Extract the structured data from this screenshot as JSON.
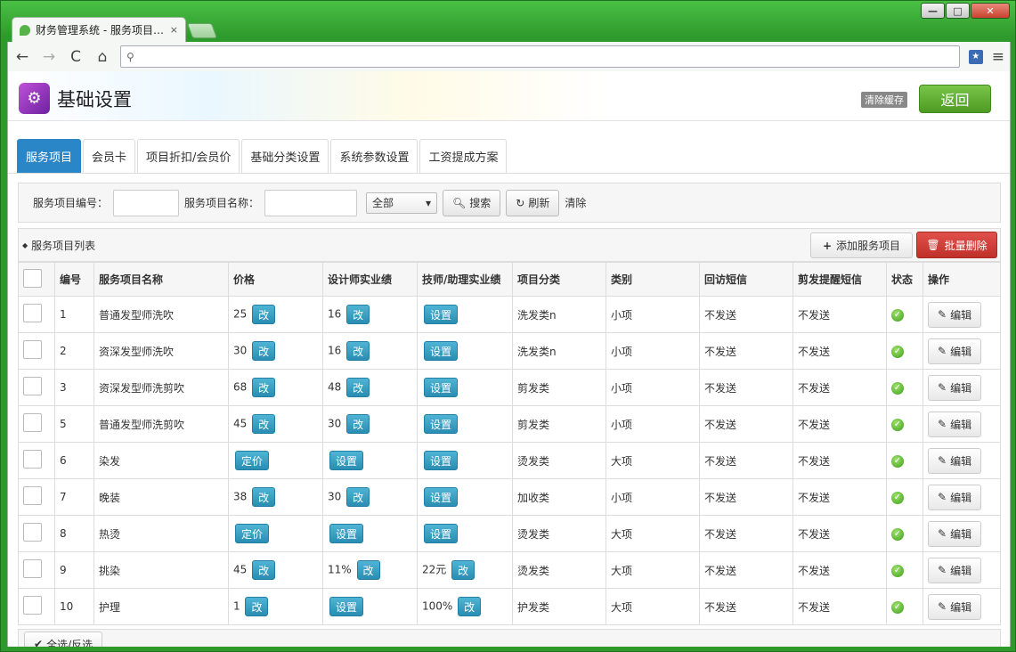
{
  "window": {
    "tab_title": "财务管理系统 - 服务项目…",
    "tab_close": "×",
    "min": "—",
    "max": "□",
    "close": "✕"
  },
  "browser": {
    "back": "←",
    "forward": "→",
    "reload": "C",
    "home": "⌂",
    "search_glyph": "⚲",
    "address_value": "",
    "bookmark": "★",
    "menu": "≡"
  },
  "app": {
    "title": "基础设置",
    "icon": "gear-icon",
    "clear_cache_label": "清除缓存",
    "back_label": "返回"
  },
  "tabs": [
    "服务项目",
    "会员卡",
    "项目折扣/会员价",
    "基础分类设置",
    "系统参数设置",
    "工资提成方案"
  ],
  "search": {
    "code_label": "服务项目编号：",
    "name_label": "服务项目名称：",
    "code_value": "",
    "name_value": "",
    "select_value": "全部",
    "search_label": "搜索",
    "refresh_label": "刷新",
    "clear_label": "清除"
  },
  "list": {
    "title": "服务项目列表",
    "add_label": "添加服务项目",
    "batch_delete_label": "批量删除",
    "select_all_label": "全选/反选"
  },
  "table": {
    "headers": [
      "编号",
      "服务项目名称",
      "价格",
      "设计师实业绩",
      "技师/助理实业绩",
      "项目分类",
      "类别",
      "回访短信",
      "剪发提醒短信",
      "状态",
      "操作"
    ],
    "change_label": "改",
    "set_label": "设置",
    "price_set_label": "定价",
    "edit_label": "编辑",
    "rows": [
      {
        "id": "1",
        "name": "普通发型师洗吹",
        "price": "25",
        "designer": "16",
        "tech": "",
        "category": "洗发类n",
        "type": "小项",
        "visit_sms": "不发送",
        "remind_sms": "不发送"
      },
      {
        "id": "2",
        "name": "资深发型师洗吹",
        "price": "30",
        "designer": "16",
        "tech": "",
        "category": "洗发类n",
        "type": "小项",
        "visit_sms": "不发送",
        "remind_sms": "不发送"
      },
      {
        "id": "3",
        "name": "资深发型师洗剪吹",
        "price": "68",
        "designer": "48",
        "tech": "",
        "category": "剪发类",
        "type": "小项",
        "visit_sms": "不发送",
        "remind_sms": "不发送"
      },
      {
        "id": "5",
        "name": "普通发型师洗剪吹",
        "price": "45",
        "designer": "30",
        "tech": "",
        "category": "剪发类",
        "type": "小项",
        "visit_sms": "不发送",
        "remind_sms": "不发送"
      },
      {
        "id": "6",
        "name": "染发",
        "price": "",
        "designer": "",
        "tech": "",
        "category": "烫发类",
        "type": "大项",
        "visit_sms": "不发送",
        "remind_sms": "不发送"
      },
      {
        "id": "7",
        "name": "晚装",
        "price": "38",
        "designer": "30",
        "tech": "",
        "category": "加收类",
        "type": "小项",
        "visit_sms": "不发送",
        "remind_sms": "不发送"
      },
      {
        "id": "8",
        "name": "热烫",
        "price": "",
        "designer": "",
        "tech": "",
        "category": "烫发类",
        "type": "大项",
        "visit_sms": "不发送",
        "remind_sms": "不发送"
      },
      {
        "id": "9",
        "name": "挑染",
        "price": "45",
        "designer": "11%",
        "tech": "22元",
        "category": "烫发类",
        "type": "大项",
        "visit_sms": "不发送",
        "remind_sms": "不发送"
      },
      {
        "id": "10",
        "name": "护理",
        "price": "1",
        "designer": "",
        "tech": "100%",
        "category": "护发类",
        "type": "大项",
        "visit_sms": "不发送",
        "remind_sms": "不发送"
      }
    ]
  }
}
